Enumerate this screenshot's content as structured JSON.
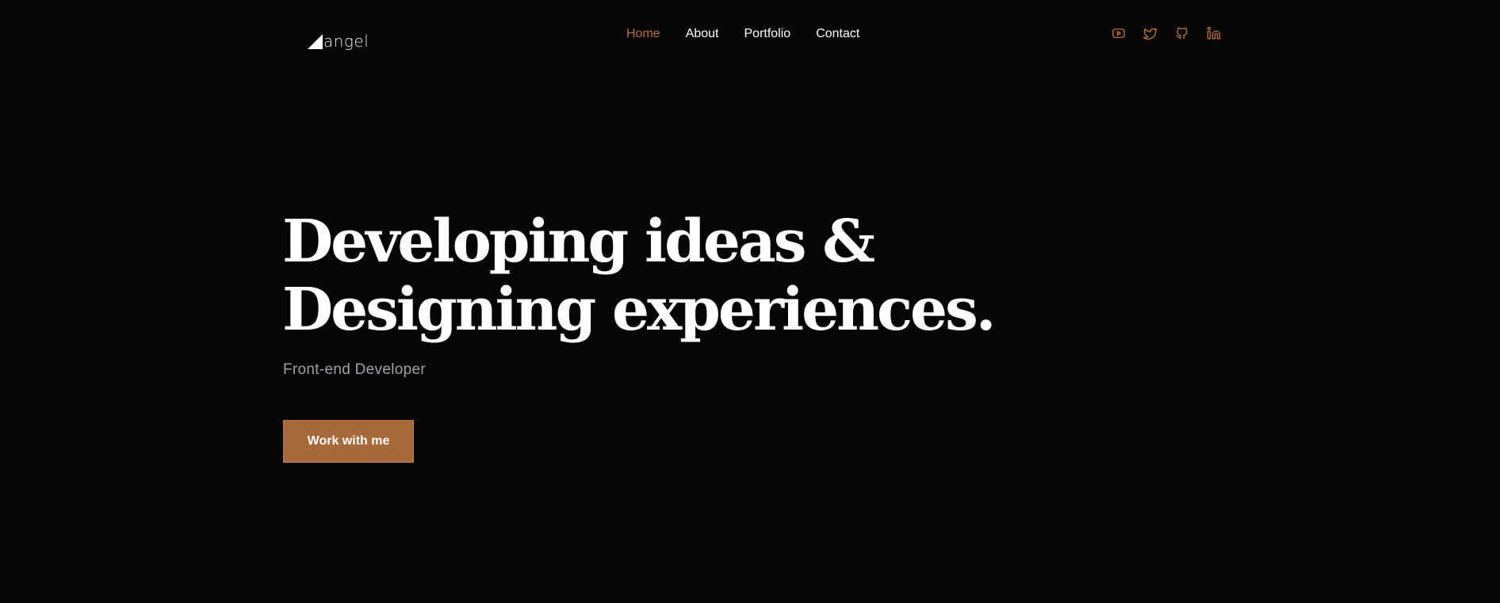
{
  "brand": {
    "logo_text": "angel"
  },
  "nav": {
    "items": [
      {
        "label": "Home",
        "active": true
      },
      {
        "label": "About",
        "active": false
      },
      {
        "label": "Portfolio",
        "active": false
      },
      {
        "label": "Contact",
        "active": false
      }
    ]
  },
  "social": {
    "icons": [
      "youtube-icon",
      "twitter-icon",
      "github-icon",
      "linkedin-icon"
    ],
    "color": "#b9723a"
  },
  "hero": {
    "title_line1": "Developing ideas &",
    "title_line2": "Designing experiences.",
    "subtitle": "Front-end Developer",
    "cta_label": "Work with me"
  },
  "colors": {
    "background": "#060606",
    "accent": "#b9723a",
    "button": "#a8693a",
    "subtitle": "#9ea3a8"
  }
}
